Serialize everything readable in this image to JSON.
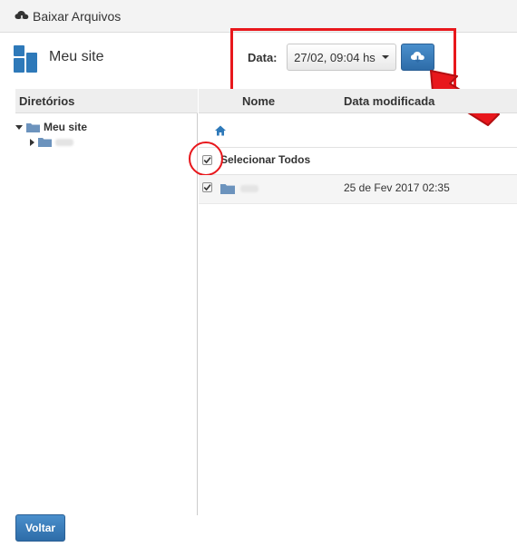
{
  "window": {
    "title": "Baixar Arquivos",
    "title_icon": "cloud-download-icon"
  },
  "site": {
    "name": "Meu site",
    "logo_icon": "site-logo-icon"
  },
  "date_picker": {
    "label": "Data:",
    "selected": "27/02, 09:04 hs",
    "download_icon": "cloud-download-icon"
  },
  "directories": {
    "header": "Diretórios",
    "root": "Meu site",
    "child": ""
  },
  "files": {
    "columns": [
      "Nome",
      "Data modificada"
    ],
    "home_icon": "home-icon",
    "select_all_label": "Selecionar Todos",
    "select_all_checked": true,
    "rows": [
      {
        "name": "",
        "modified": "25 de Fev 2017 02:35",
        "checked": true
      }
    ]
  },
  "footer": {
    "back_label": "Voltar"
  },
  "colors": {
    "accent": "#337ab7",
    "highlight": "#e8171c"
  }
}
